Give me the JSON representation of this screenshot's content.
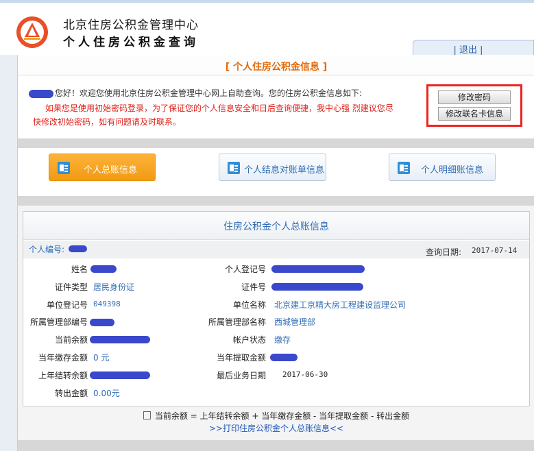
{
  "header": {
    "org_name": "北京住房公积金管理中心",
    "app_name": "个人住房公积金查询",
    "logout_label": "| 退出 |"
  },
  "info": {
    "section_title": "[ 个人住房公积金信息 ]",
    "welcome_text": "您好！欢迎您使用北京住房公积金管理中心网上自助查询。您的住房公积金信息如下:",
    "warning_line1": "如果您是使用初始密码登录，为了保证您的个人信息安全和日后查询便捷，我中心强 烈建议您尽",
    "warning_line2": "快修改初始密码，如有问题请及时联系。",
    "change_password_label": "修改密码",
    "change_card_label": "修改联名卡信息"
  },
  "nav": {
    "tabs": [
      {
        "label": "个人总账信息",
        "active": true
      },
      {
        "label": "个人结息对账单信息",
        "active": false
      },
      {
        "label": "个人明细账信息",
        "active": false
      }
    ]
  },
  "summary": {
    "title": "住房公积金个人总账信息",
    "personal_id_label": "个人编号:",
    "query_date_label": "查询日期:",
    "query_date": "2017-07-14",
    "fields": {
      "name_label": "姓名",
      "personal_reg_label": "个人登记号",
      "cert_type_label": "证件类型",
      "cert_type_value": "居民身份证",
      "cert_no_label": "证件号",
      "unit_reg_label": "单位登记号",
      "unit_reg_value": "049398",
      "unit_name_label": "单位名称",
      "unit_name_value": "北京建工京精大房工程建设监理公司",
      "dept_no_label": "所属管理部编号",
      "dept_name_label": "所属管理部名称",
      "dept_name_value": "西城管理部",
      "balance_label": "当前余额",
      "account_status_label": "帐户状态",
      "account_status_value": "缴存",
      "year_deposit_label": "当年缴存金额",
      "year_deposit_value": "0 元",
      "year_withdraw_label": "当年提取金额",
      "last_year_carry_label": "上年结转余额",
      "last_business_date_label": "最后业务日期",
      "last_business_date_value": "2017-06-30",
      "transfer_out_label": "转出金额",
      "transfer_out_value": "0.00元"
    },
    "formula": "当前余额 = 上年结转余额 + 当年缴存金额 - 当年提取金额 - 转出金额",
    "print_link": ">>打印住房公积金个人总账信息<<"
  },
  "colors": {
    "accent_orange": "#e36a0a",
    "link_blue": "#2f6cb5",
    "warning_red": "#e0231b",
    "highlight_frame": "#f0211f",
    "redaction": "#3a48cc"
  }
}
